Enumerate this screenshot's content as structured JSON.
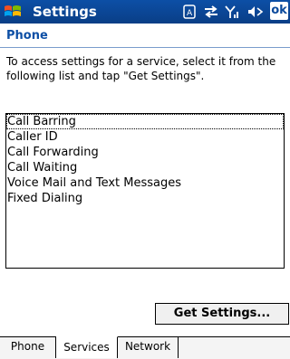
{
  "titlebar": {
    "title": "Settings",
    "ok_label": "ok",
    "status_icons": [
      "data-icon",
      "connectivity-icon",
      "signal-icon",
      "volume-icon"
    ]
  },
  "page": {
    "section_title": "Phone",
    "instructions": "To access settings for a service, select it from the following list and tap \"Get Settings\"."
  },
  "services_list": {
    "items": [
      "Call Barring",
      "Caller ID",
      "Call Forwarding",
      "Call Waiting",
      "Voice Mail and Text Messages",
      "Fixed Dialing"
    ],
    "focused_index": 0
  },
  "buttons": {
    "get_settings": "Get Settings..."
  },
  "tabs": [
    {
      "label": "Phone",
      "active": false
    },
    {
      "label": "Services",
      "active": true
    },
    {
      "label": "Network",
      "active": false
    }
  ],
  "colors": {
    "titlebar": "#0c4fa6",
    "section_title": "#0d4fa5"
  }
}
